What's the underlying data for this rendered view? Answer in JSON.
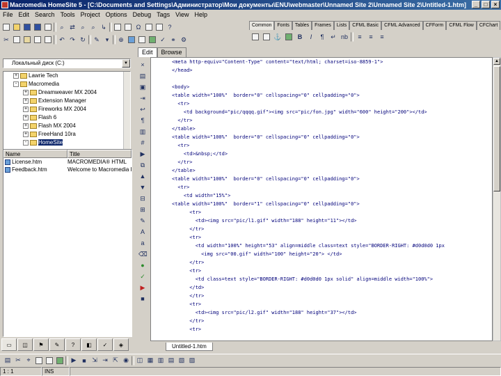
{
  "window": {
    "title": "Macromedia HomeSite 5 - [C:\\Documents and Settings\\Администратор\\Мои документы\\ENU\\webmaster\\Unnamed Site 2\\Unnamed Site 2\\Untitled-1.htm]",
    "buttons": [
      "_",
      "□",
      "×"
    ]
  },
  "menu": [
    "File",
    "Edit",
    "Search",
    "Tools",
    "Project",
    "Options",
    "Debug",
    "Tags",
    "View",
    "Help"
  ],
  "quickbar": {
    "tabs": [
      "Common",
      "Fonts",
      "Tables",
      "Frames",
      "Lists",
      "CFML Basic",
      "CFML Advanced",
      "CFForm",
      "CFML Flow",
      "CFChart"
    ],
    "active_index": 0
  },
  "resource": {
    "drive": "Локальный диск (C:)",
    "tree": [
      {
        "label": "Lawrie Tech",
        "indent": 1,
        "expander": "+"
      },
      {
        "label": "Macromedia",
        "indent": 1,
        "expander": "-"
      },
      {
        "label": "Dreamweaver MX 2004",
        "indent": 2,
        "expander": "+"
      },
      {
        "label": "Extension Manager",
        "indent": 2,
        "expander": "+"
      },
      {
        "label": "Fireworks MX 2004",
        "indent": 2,
        "expander": "+"
      },
      {
        "label": "Flash 6",
        "indent": 2,
        "expander": "+"
      },
      {
        "label": "Flash MX 2004",
        "indent": 2,
        "expander": "+"
      },
      {
        "label": "FreeHand 10ra",
        "indent": 2,
        "expander": "+"
      },
      {
        "label": "HomeSite",
        "indent": 2,
        "expander": "-",
        "selected": true
      }
    ],
    "file_columns": [
      "Name",
      "Title"
    ],
    "files": [
      {
        "name": "License.htm",
        "title": "MACROMEDIA® HTML"
      },
      {
        "name": "Feedback.htm",
        "title": "Welcome to Macromedia H"
      }
    ]
  },
  "doc_tabs": [
    "Edit",
    "Browse"
  ],
  "active_doc_tab": 0,
  "file_tabs": [
    "Untitled-1.htm"
  ],
  "code": [
    "<meta http-equiv=\"Content-Type\" content=\"text/html; charset=iso-8859-1\">",
    "</head>",
    "",
    "<body>",
    "<table width=\"100%\"  border=\"0\" cellspacing=\"0\" cellpadding=\"0\">",
    "  <tr>",
    "    <td background=\"pic/qqqq.gif\"><img src=\"pic/fon.jpg\" width=\"600\" height=\"200\"></td>",
    "  </tr>",
    "</table>",
    "<table width=\"100%\"  border=\"0\" cellspacing=\"0\" cellpadding=\"0\">",
    "  <tr>",
    "    <td>&nbsp;</td>",
    "  </tr>",
    "</table>",
    "<table width=\"100%\"  border=\"0\" cellspacing=\"0\" cellpadding=\"0\">",
    "  <tr>",
    "    <td width=\"15%\">",
    "<table width=\"100%\"  border=\"1\" cellspacing=\"0\" cellpadding=\"0\">",
    "      <tr>",
    "        <td><img src=\"pic/l1.gif\" width=\"188\" height=\"11\"></td>",
    "      </tr>",
    "      <tr>",
    "        <td width=\"100%\" height=\"53\" align=middle class=text style=\"BORDER-RIGHT: #d0d0d0 1px",
    "          <img src=\"00.gif\" width=\"100\" height=\"20\"> </td>",
    "      </tr>",
    "      <tr>",
    "        <td class=text style=\"BORDER-RIGHT: #d0d0d0 1px solid\" align=middle width=\"100%\">",
    "      </td>",
    "      </tr>",
    "      <tr>",
    "        <td><img src=\"pic/l2.gif\" width=\"188\" height=\"37\"></td>",
    "      </tr>",
    "      <tr>"
  ],
  "status": {
    "position": "1 : 1",
    "mode": "INS"
  },
  "colors": {
    "title_from": "#0a246a",
    "title_to": "#3a6ea5",
    "code": "#00007a"
  }
}
